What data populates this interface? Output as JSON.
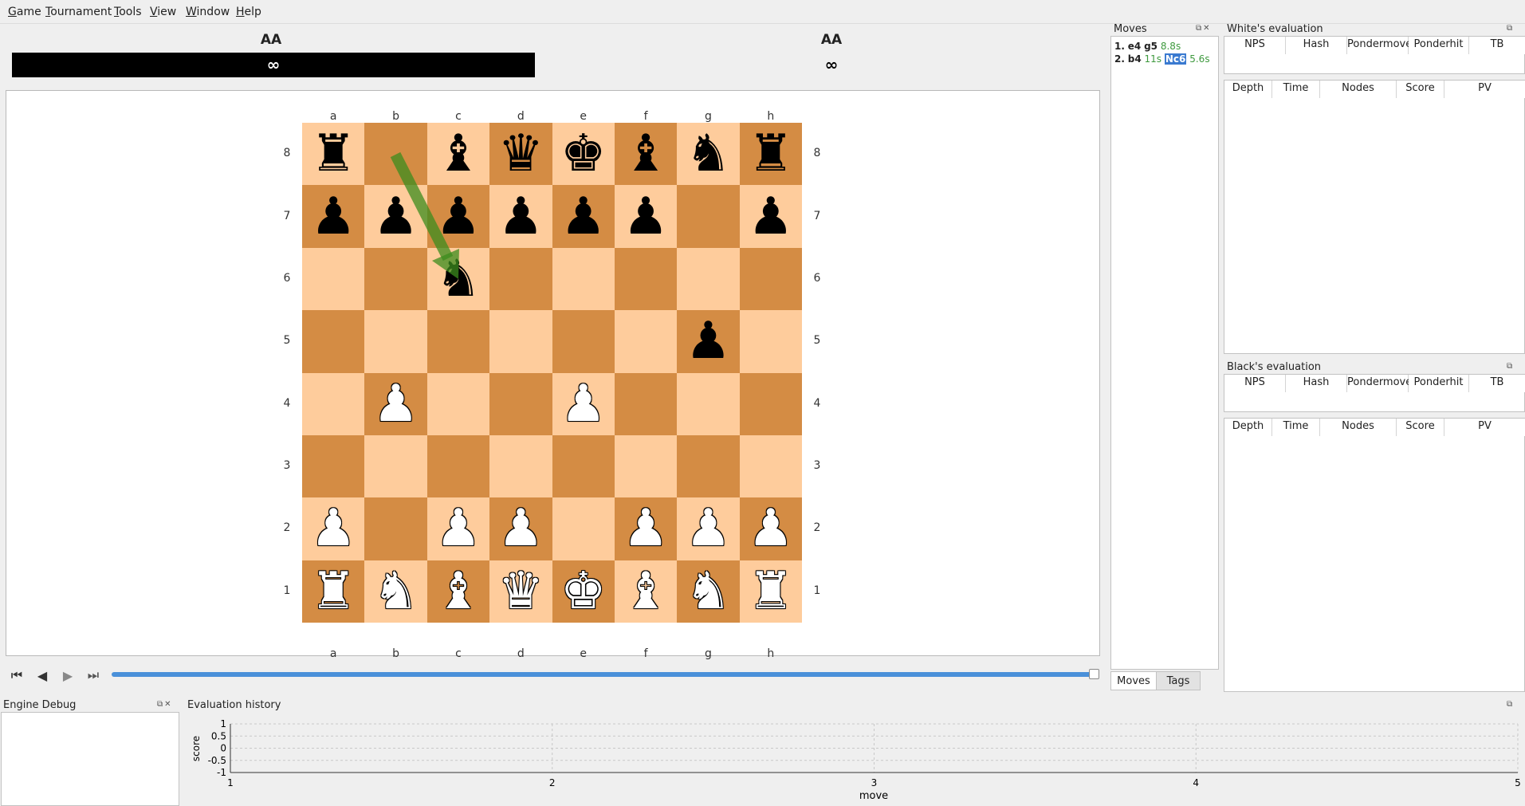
{
  "menu": [
    "Game",
    "Tournament",
    "Tools",
    "View",
    "Window",
    "Help"
  ],
  "white_player": {
    "name": "AA",
    "clock": "∞"
  },
  "black_player": {
    "name": "AA",
    "clock": "∞"
  },
  "board": {
    "files": [
      "a",
      "b",
      "c",
      "d",
      "e",
      "f",
      "g",
      "h"
    ],
    "ranks": [
      "8",
      "7",
      "6",
      "5",
      "4",
      "3",
      "2",
      "1"
    ],
    "rows": [
      [
        "r",
        "",
        "b",
        "q",
        "k",
        "b",
        "n",
        "r"
      ],
      [
        "p",
        "p",
        "p",
        "p",
        "p",
        "p",
        "",
        "p"
      ],
      [
        "",
        "",
        "n",
        "",
        "",
        "",
        "",
        ""
      ],
      [
        "",
        "",
        "",
        "",
        "",
        "",
        "p",
        ""
      ],
      [
        "",
        "P",
        "",
        "",
        "P",
        "",
        "",
        ""
      ],
      [
        "",
        "",
        "",
        "",
        "",
        "",
        "",
        ""
      ],
      [
        "P",
        "",
        "P",
        "P",
        "",
        "P",
        "P",
        "P"
      ],
      [
        "R",
        "N",
        "B",
        "Q",
        "K",
        "B",
        "N",
        "R"
      ]
    ],
    "last_move_arrow": {
      "from": "b8",
      "to": "c6",
      "color": "#3c8c1e"
    }
  },
  "moves_panel": {
    "title": "Moves",
    "lines": [
      {
        "num": "1.",
        "white": "e4",
        "black": "g5",
        "black_time": "8.8s"
      },
      {
        "num": "2.",
        "white": "b4",
        "white_time": "11s",
        "black": "Nc6",
        "black_time": "5.6s"
      }
    ],
    "tabs": [
      "Moves",
      "Tags"
    ]
  },
  "white_eval": {
    "title": "White's evaluation",
    "stats_cols": [
      "NPS",
      "Hash",
      "Pondermove",
      "Ponderhit",
      "TB"
    ],
    "pv_cols": [
      "Depth",
      "Time",
      "Nodes",
      "Score",
      "PV"
    ]
  },
  "black_eval": {
    "title": "Black's evaluation",
    "stats_cols": [
      "NPS",
      "Hash",
      "Pondermove",
      "Ponderhit",
      "TB"
    ],
    "pv_cols": [
      "Depth",
      "Time",
      "Nodes",
      "Score",
      "PV"
    ]
  },
  "engine_debug": {
    "title": "Engine Debug"
  },
  "eval_history": {
    "title": "Evaluation history",
    "ylabel": "score",
    "xlabel": "move",
    "y_ticks": [
      "1",
      "0.5",
      "0",
      "-0.5",
      "-1"
    ],
    "x_ticks": [
      "1",
      "2",
      "3",
      "4",
      "5"
    ]
  },
  "colors": {
    "light_square": "#fecc9c",
    "dark_square": "#d48c44",
    "slider": "#4a90d9",
    "time_green": "#3f9a3f",
    "selected_move": "#3a7ad0"
  }
}
